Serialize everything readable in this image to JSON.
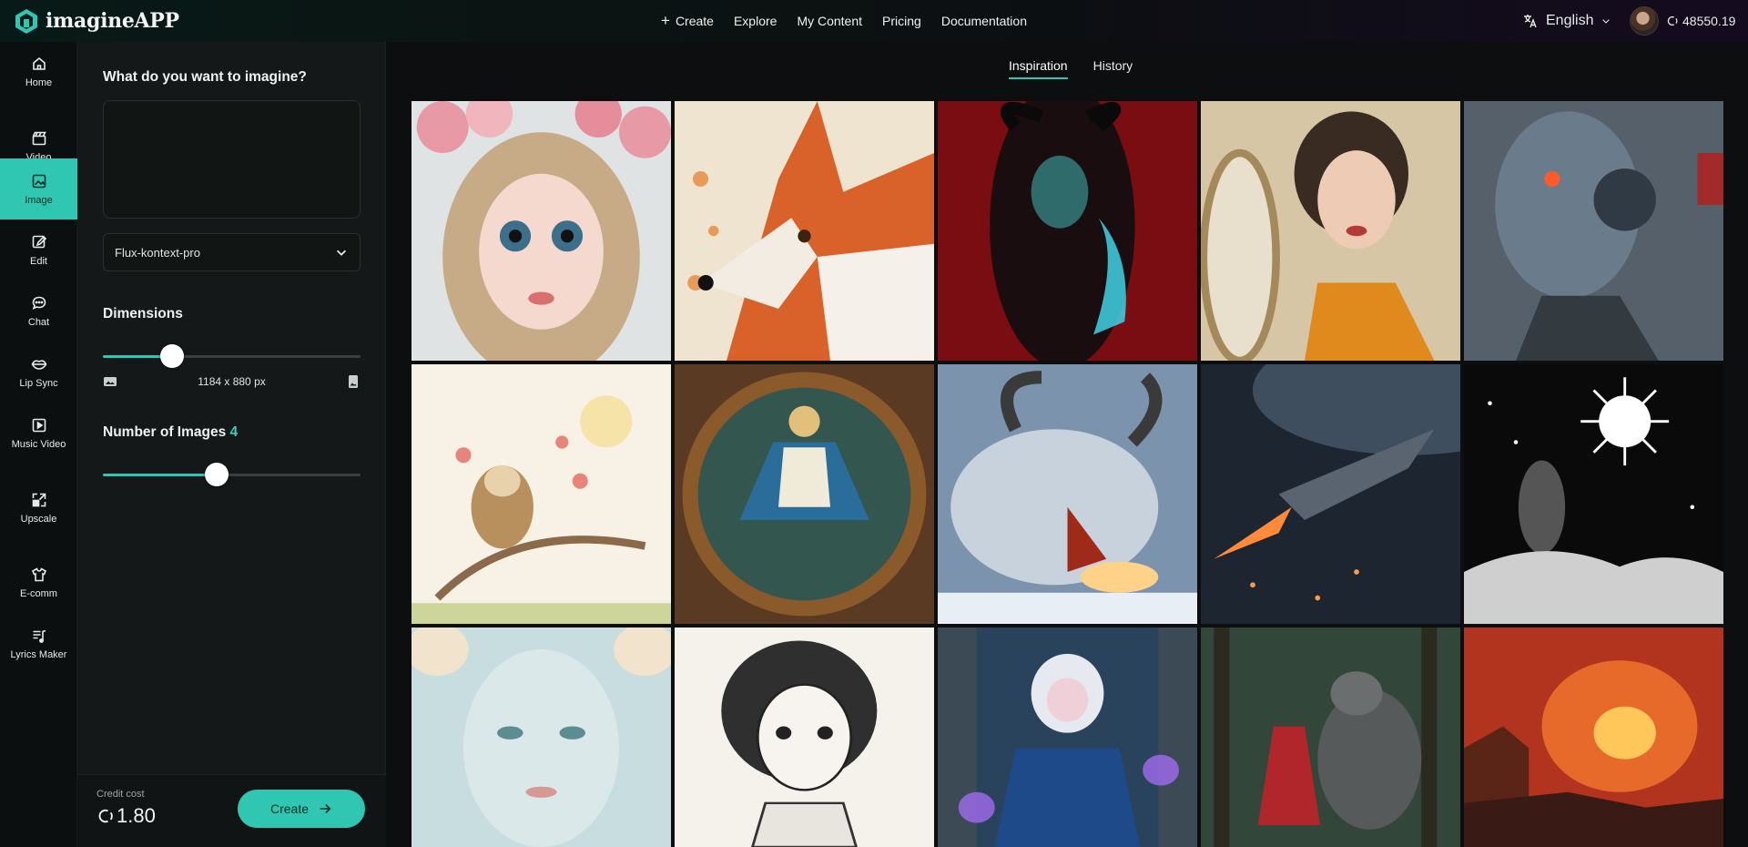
{
  "app": {
    "name": "imagineAPP"
  },
  "header": {
    "nav": [
      {
        "label": "Create",
        "icon": "plus-icon"
      },
      {
        "label": "Explore"
      },
      {
        "label": "My Content"
      },
      {
        "label": "Pricing"
      },
      {
        "label": "Documentation"
      }
    ],
    "language": "English",
    "credits": "48550.19"
  },
  "sidebar": {
    "items": [
      {
        "label": "Home",
        "icon": "home-icon"
      },
      {
        "label": "Video",
        "icon": "clapperboard-icon"
      },
      {
        "label": "Image",
        "icon": "image-icon",
        "active": true
      },
      {
        "label": "Edit",
        "icon": "edit-icon"
      },
      {
        "label": "Chat",
        "icon": "chat-icon"
      },
      {
        "label": "Lip Sync",
        "icon": "lips-icon"
      },
      {
        "label": "Music Video",
        "icon": "music-video-icon"
      },
      {
        "label": "Upscale",
        "icon": "upscale-icon"
      },
      {
        "label": "E-comm",
        "icon": "shirt-icon"
      },
      {
        "label": "Lyrics Maker",
        "icon": "lyrics-icon"
      }
    ]
  },
  "panel": {
    "prompt_title": "What do you want to imagine?",
    "prompt_value": "",
    "model": "Flux-kontext-pro",
    "dimensions_label": "Dimensions",
    "dimensions_value": "1184 x 880 px",
    "dimensions_level": 0.27,
    "num_images_label": "Number of Images",
    "num_images_value": "4",
    "num_images_level": 0.44,
    "credit_cost_label": "Credit cost",
    "credit_cost_value": "1.80",
    "create_label": "Create"
  },
  "main": {
    "tabs": [
      {
        "label": "Inspiration",
        "active": true
      },
      {
        "label": "History"
      }
    ]
  },
  "colors": {
    "accent": "#2fc7b1",
    "panel": "#141818",
    "rail": "#0b0f0f"
  }
}
